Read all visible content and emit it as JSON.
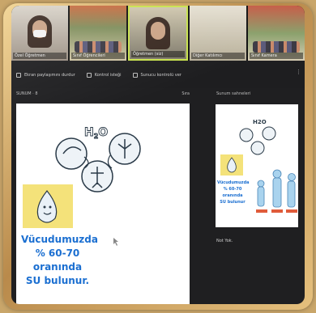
{
  "participants": [
    {
      "label": "Özel Öğretmen",
      "kind": "masked"
    },
    {
      "label": "Sınıf Öğrencileri",
      "kind": "class"
    },
    {
      "label": "Öğretmen (siz)",
      "kind": "active"
    },
    {
      "label": "Diğer Katılımcı",
      "kind": "blank"
    },
    {
      "label": "Sınıf Kamera",
      "kind": "class"
    }
  ],
  "toolbar": {
    "items": [
      {
        "label": "Ekran paylaşımını durdur",
        "icon": "stop-share-icon"
      },
      {
        "label": "Kontrol isteği",
        "icon": "control-icon"
      },
      {
        "label": "Sunucu kontrolü ver",
        "icon": "presenter-icon"
      }
    ],
    "more": "⋮"
  },
  "main_pane": {
    "title": "SUNUM · 8",
    "right": "Sıra"
  },
  "slide": {
    "molecule": "H2O",
    "line1": "Vücudumuzda",
    "line2": "% 60-70",
    "line3": "oranında",
    "line4": "SU bulunur."
  },
  "right_panel": {
    "title": "Sunum sahneleri",
    "preview_text": [
      "Vücudumuzda",
      "% 60-70",
      "oranında",
      "SU bulunur"
    ],
    "note": "Not Yok."
  },
  "colors": {
    "frame": "#c9a66a",
    "app_bg": "#1f1f21",
    "slide_text": "#1b6fd1",
    "sticky": "#f4e27a",
    "active_speaker": "#c8e24c"
  }
}
